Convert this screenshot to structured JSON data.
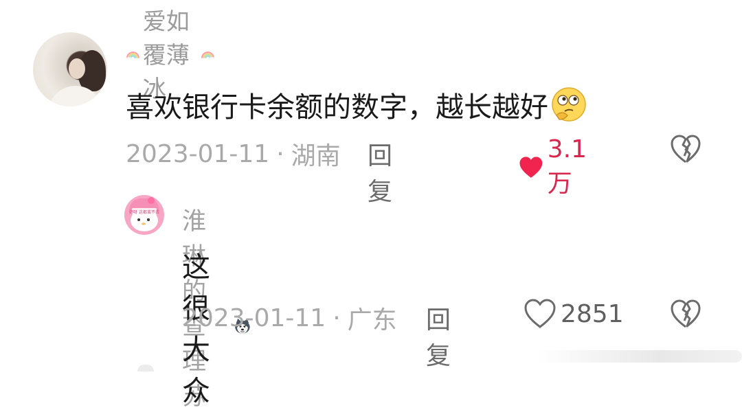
{
  "comment": {
    "username": "爱如覆薄冰",
    "text": "喜欢银行卡余额的数字，越长越好",
    "date": "2023-01-11",
    "separator": "·",
    "location": "湖南",
    "reply_label": "回复",
    "likes": "3.1万",
    "liked": true,
    "username_icon": "rainbow-icon",
    "emoji": "thinking-face-emoji"
  },
  "reply": {
    "username": "淮琳的查理苏",
    "text": "这很大众",
    "date": "2023-01-11",
    "separator": "·",
    "location": "广东",
    "reply_label": "回复",
    "likes": "2851",
    "liked": false,
    "emoji": "husky-dog-emoji",
    "avatar_caption": "好呀 这都蛮不去"
  },
  "colors": {
    "like_active": "#f0244e",
    "like_count_active": "#d8264e",
    "meta_gray": "#a9a9a9",
    "text_dark": "#1a1a1a"
  }
}
